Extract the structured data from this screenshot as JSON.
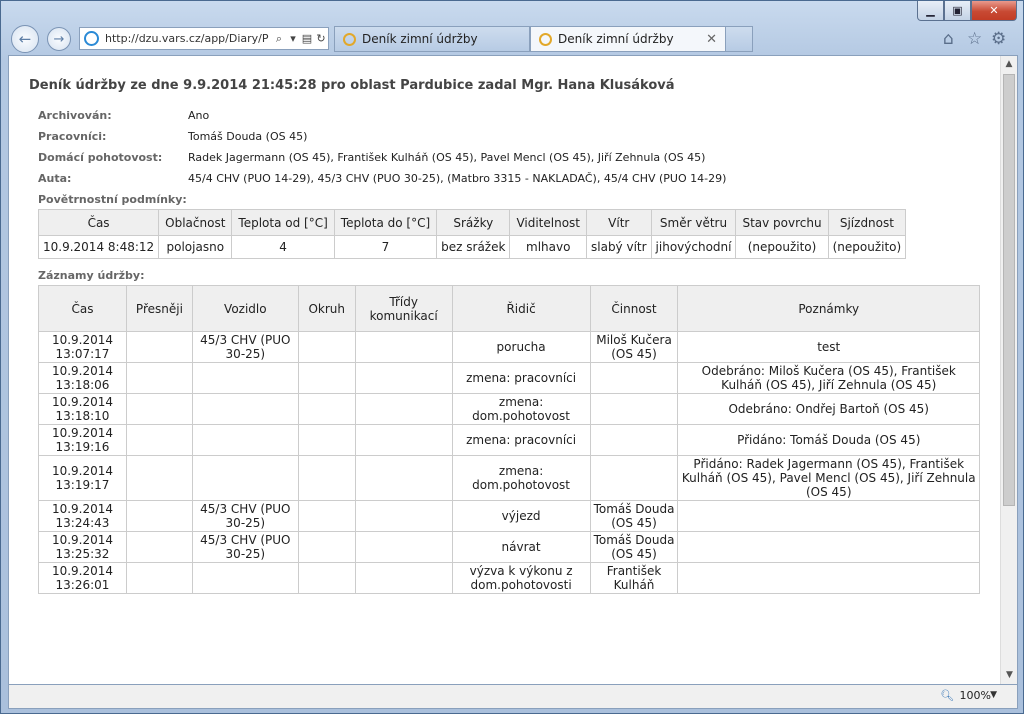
{
  "browser": {
    "address": "http://dzu.vars.cz/app/Diary/P",
    "tabs": [
      {
        "label": "Deník zimní údržby",
        "active": false
      },
      {
        "label": "Deník zimní údržby",
        "active": true
      }
    ],
    "zoom": "100%"
  },
  "page": {
    "title": "Deník údržby ze dne 9.9.2014 21:45:28 pro oblast Pardubice zadal Mgr. Hana Klusáková",
    "info": [
      {
        "label": "Archivován:",
        "value": "Ano"
      },
      {
        "label": "Pracovníci:",
        "value": "Tomáš Douda (OS 45)"
      },
      {
        "label": "Domácí pohotovost:",
        "value": "Radek Jagermann (OS 45), František Kulháň (OS 45), Pavel Mencl (OS 45), Jiří Zehnula (OS 45)"
      },
      {
        "label": "Auta:",
        "value": "45/4 CHV (PUO 14-29), 45/3 CHV (PUO 30-25), (Matbro 3315 - NAKLADAČ), 45/4 CHV (PUO 14-29)"
      }
    ],
    "weather_label": "Povětrnostní podmínky:",
    "weather": {
      "headers": [
        "Čas",
        "Oblačnost",
        "Teplota od [°C]",
        "Teplota do [°C]",
        "Srážky",
        "Viditelnost",
        "Vítr",
        "Směr větru",
        "Stav povrchu",
        "Sjízdnost"
      ],
      "row": [
        "10.9.2014 8:48:12",
        "polojasno",
        "4",
        "7",
        "bez srážek",
        "mlhavo",
        "slabý vítr",
        "jihovýchodní",
        "(nepoužito)",
        "(nepoužito)"
      ]
    },
    "records_label": "Záznamy údržby:",
    "records": {
      "headers": [
        "Čas",
        "Přesněji",
        "Vozidlo",
        "Okruh",
        "Třídy komunikací",
        "Řidič",
        "Činnost",
        "Poznámky"
      ],
      "rows": [
        [
          "10.9.2014 13:07:17",
          "",
          "45/3 CHV (PUO 30-25)",
          "",
          "",
          "porucha",
          "Miloš Kučera (OS 45)",
          "test"
        ],
        [
          "10.9.2014 13:18:06",
          "",
          "",
          "",
          "",
          "zmena: pracovníci",
          "",
          "Odebráno: Miloš Kučera (OS 45), František Kulháň (OS 45), Jiří Zehnula (OS 45)"
        ],
        [
          "10.9.2014 13:18:10",
          "",
          "",
          "",
          "",
          "zmena: dom.pohotovost",
          "",
          "Odebráno: Ondřej Bartoň (OS 45)"
        ],
        [
          "10.9.2014 13:19:16",
          "",
          "",
          "",
          "",
          "zmena: pracovníci",
          "",
          "Přidáno: Tomáš Douda (OS 45)"
        ],
        [
          "10.9.2014 13:19:17",
          "",
          "",
          "",
          "",
          "zmena: dom.pohotovost",
          "",
          "Přidáno: Radek Jagermann (OS 45), František Kulháň (OS 45), Pavel Mencl (OS 45), Jiří Zehnula (OS 45)"
        ],
        [
          "10.9.2014 13:24:43",
          "",
          "45/3 CHV (PUO 30-25)",
          "",
          "",
          "výjezd",
          "Tomáš Douda (OS 45)",
          ""
        ],
        [
          "10.9.2014 13:25:32",
          "",
          "45/3 CHV (PUO 30-25)",
          "",
          "",
          "návrat",
          "Tomáš Douda (OS 45)",
          ""
        ],
        [
          "10.9.2014 13:26:01",
          "",
          "",
          "",
          "",
          "výzva k výkonu z dom.pohotovosti",
          "František Kulháň",
          ""
        ]
      ]
    }
  }
}
